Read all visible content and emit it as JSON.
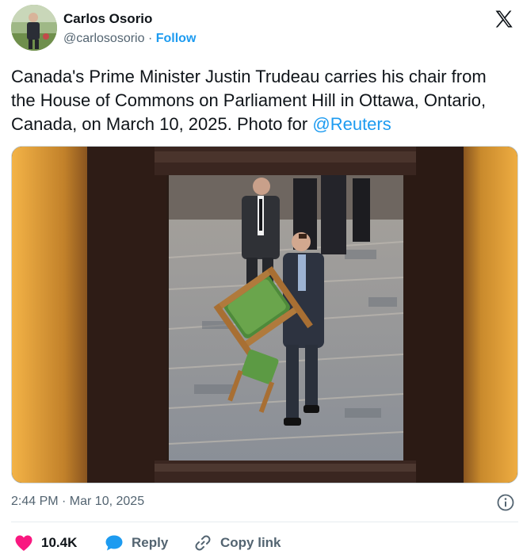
{
  "author": {
    "name": "Carlos Osorio",
    "handle": "@carlososorio",
    "separator": "·",
    "follow_label": "Follow"
  },
  "tweet": {
    "text": "Canada's Prime Minister Justin Trudeau carries his chair from the House of Commons on Parliament Hill in Ottawa, Ontario, Canada, on March 10, 2025. Photo for",
    "mention": "@Reuters",
    "timestamp": "2:44 PM · Mar 10, 2025"
  },
  "actions": {
    "like_count": "10.4K",
    "reply_label": "Reply",
    "copy_link_label": "Copy link"
  },
  "colors": {
    "link": "#1d9bf0",
    "like": "#f91880",
    "text_primary": "#0f1419",
    "text_secondary": "#536471"
  },
  "icons": {
    "logo": "x-logo-icon",
    "info": "info-icon",
    "like": "heart-icon",
    "reply": "speech-bubble-icon",
    "copy": "link-icon"
  }
}
